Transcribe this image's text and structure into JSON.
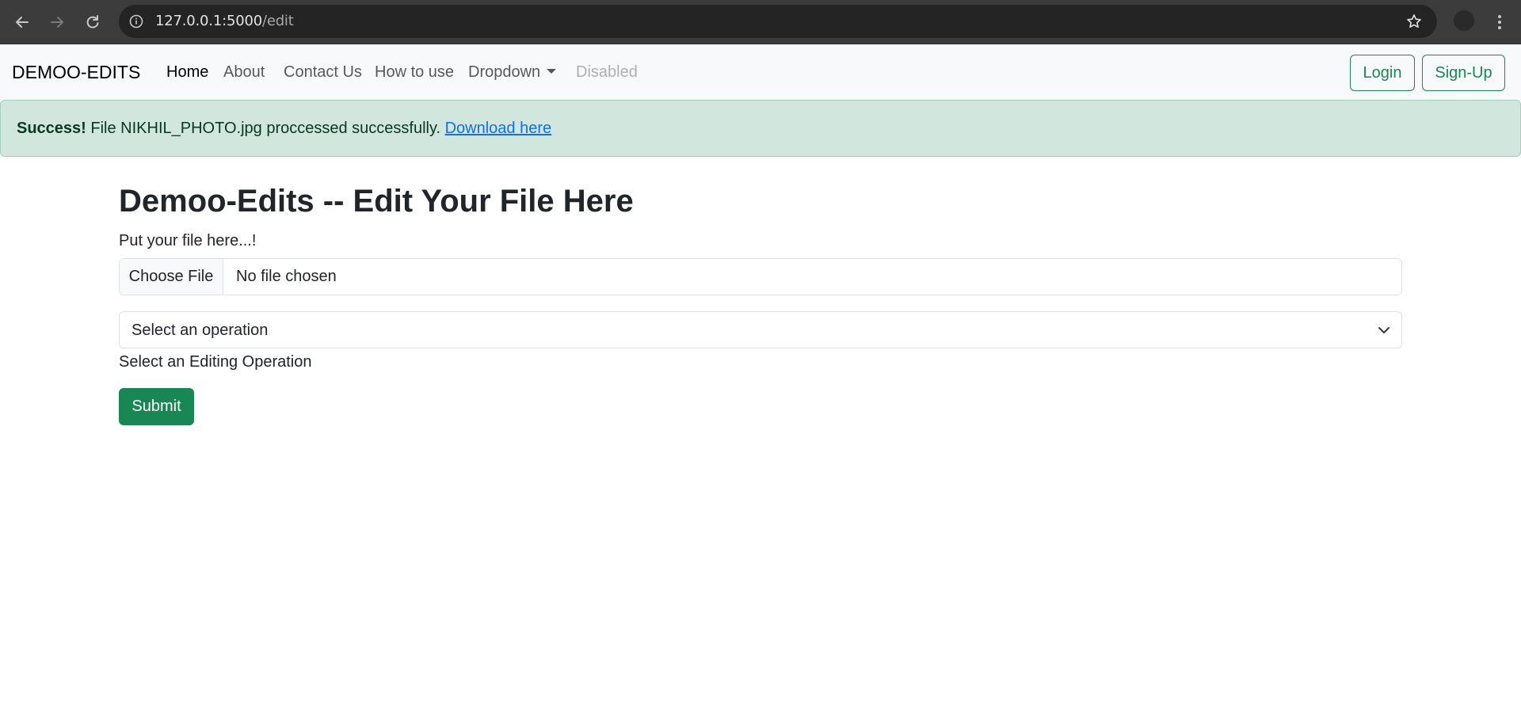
{
  "browser": {
    "url_host": "127.0.0.1:5000",
    "url_path": "/edit"
  },
  "navbar": {
    "brand": "DEMOO-EDITS",
    "items": [
      {
        "label": "Home",
        "state": "active"
      },
      {
        "label": "About",
        "state": "normal"
      },
      {
        "label": "Contact Us",
        "state": "normal"
      },
      {
        "label": "How to use",
        "state": "normal"
      },
      {
        "label": "Dropdown",
        "state": "normal"
      },
      {
        "label": "Disabled",
        "state": "disabled"
      }
    ],
    "login_label": "Login",
    "signup_label": "Sign-Up"
  },
  "alert": {
    "strong": "Success!",
    "message": " File NIKHIL_PHOTO.jpg proccessed successfully. ",
    "link_text": "Download here"
  },
  "main": {
    "title": "Demoo-Edits -- Edit Your File Here",
    "file_label": "Put your file here...!",
    "file_button": "Choose File",
    "file_status": "No file chosen",
    "select_value": "Select an operation",
    "select_help": "Select an Editing Operation",
    "submit_label": "Submit"
  },
  "colors": {
    "success": "#198754",
    "alert_bg": "#d1e7dd",
    "link": "#0d6efd",
    "chrome_bg": "#3c3c3c"
  },
  "icons": [
    "back-icon",
    "forward-icon",
    "reload-icon",
    "site-info-icon",
    "star-icon",
    "profile-icon",
    "kebab-menu-icon",
    "chevron-down-icon"
  ]
}
